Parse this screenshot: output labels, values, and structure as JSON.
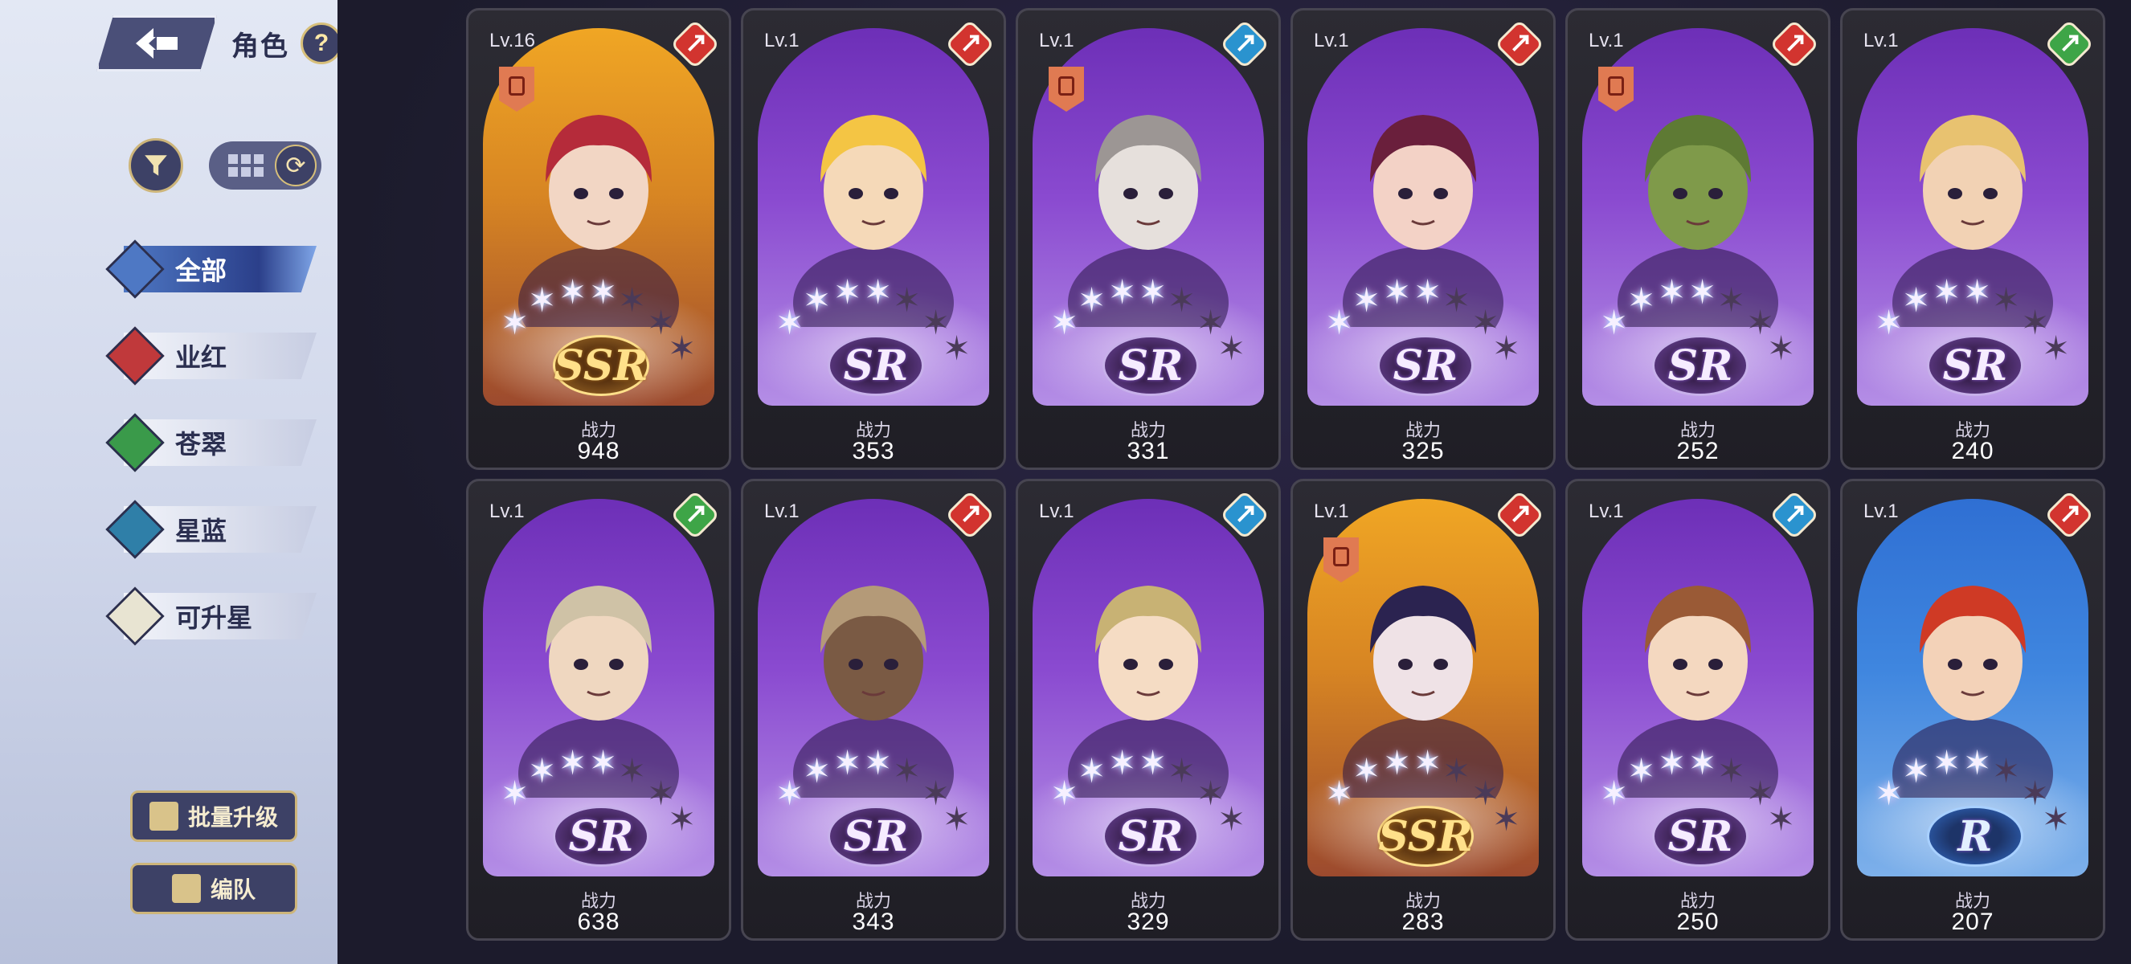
{
  "header": {
    "title": "角色",
    "help": "?"
  },
  "categories": [
    {
      "label": "全部",
      "color": "#4e78c4"
    },
    {
      "label": "业红",
      "color": "#c0393b"
    },
    {
      "label": "苍翠",
      "color": "#3a9a4a"
    },
    {
      "label": "星蓝",
      "color": "#2f7fa8"
    },
    {
      "label": "可升星",
      "color": "#e8e4d2"
    }
  ],
  "buttons": {
    "batch_upgrade": "批量升级",
    "team": "编队"
  },
  "power_label": "战力",
  "cards": [
    {
      "level": "Lv.16",
      "rarity": "SSR",
      "element": "red",
      "power": "948"
    },
    {
      "level": "Lv.1",
      "rarity": "SR",
      "element": "red",
      "power": "353"
    },
    {
      "level": "Lv.1",
      "rarity": "SR",
      "element": "blue",
      "power": "331"
    },
    {
      "level": "Lv.1",
      "rarity": "SR",
      "element": "red",
      "power": "325"
    },
    {
      "level": "Lv.1",
      "rarity": "SR",
      "element": "red",
      "power": "252"
    },
    {
      "level": "Lv.1",
      "rarity": "SR",
      "element": "green",
      "power": "240"
    },
    {
      "level": "Lv.1",
      "rarity": "SR",
      "element": "green",
      "power": "638"
    },
    {
      "level": "Lv.1",
      "rarity": "SR",
      "element": "red",
      "power": "343"
    },
    {
      "level": "Lv.1",
      "rarity": "SR",
      "element": "blue",
      "power": "329"
    },
    {
      "level": "Lv.1",
      "rarity": "SSR",
      "element": "red",
      "power": "283"
    },
    {
      "level": "Lv.1",
      "rarity": "SR",
      "element": "blue",
      "power": "250"
    },
    {
      "level": "Lv.1",
      "rarity": "R",
      "element": "red",
      "power": "207"
    }
  ]
}
